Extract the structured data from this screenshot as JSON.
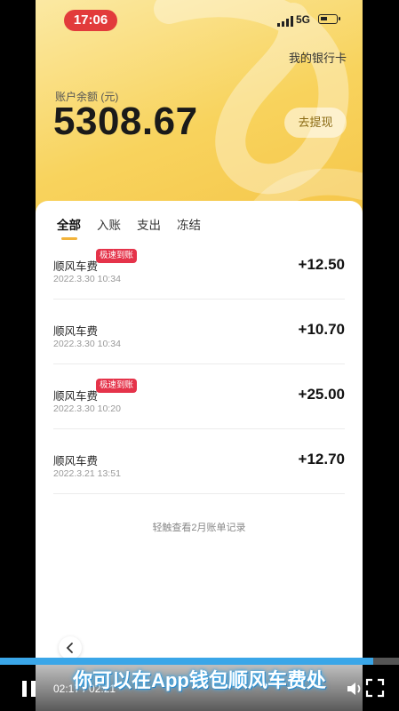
{
  "status": {
    "time": "17:06",
    "network": "5G"
  },
  "header": {
    "cards_link": "我的银行卡",
    "balance_label": "账户余额 (元)",
    "balance": "5308.67",
    "withdraw_label": "去提现"
  },
  "tabs": [
    {
      "label": "全部"
    },
    {
      "label": "入账"
    },
    {
      "label": "支出"
    },
    {
      "label": "冻结"
    }
  ],
  "transactions": [
    {
      "name": "顺风车费",
      "badge": "极速到账",
      "date": "2022.3.30 10:34",
      "amount": "+12.50"
    },
    {
      "name": "顺风车费",
      "badge": "",
      "date": "2022.3.30 10:34",
      "amount": "+10.70"
    },
    {
      "name": "顺风车费",
      "badge": "极速到账",
      "date": "2022.3.30 10:20",
      "amount": "+25.00"
    },
    {
      "name": "顺风车费",
      "badge": "",
      "date": "2022.3.21 13:51",
      "amount": "+12.70"
    }
  ],
  "more_link": "轻触查看2月账单记录",
  "video": {
    "current_time": "02:17 / 02:21",
    "subtitle": "你可以在App钱包顺风车费处",
    "progress": 0.935
  },
  "colors": {
    "accent": "#f2b33a",
    "badge": "#e5334a",
    "time_pill": "#e23b3b",
    "progress": "#3aa6e8"
  },
  "icons": {
    "back": "chevron-left-icon",
    "play": "pause-icon",
    "volume": "volume-icon",
    "fullscreen": "fullscreen-icon"
  }
}
